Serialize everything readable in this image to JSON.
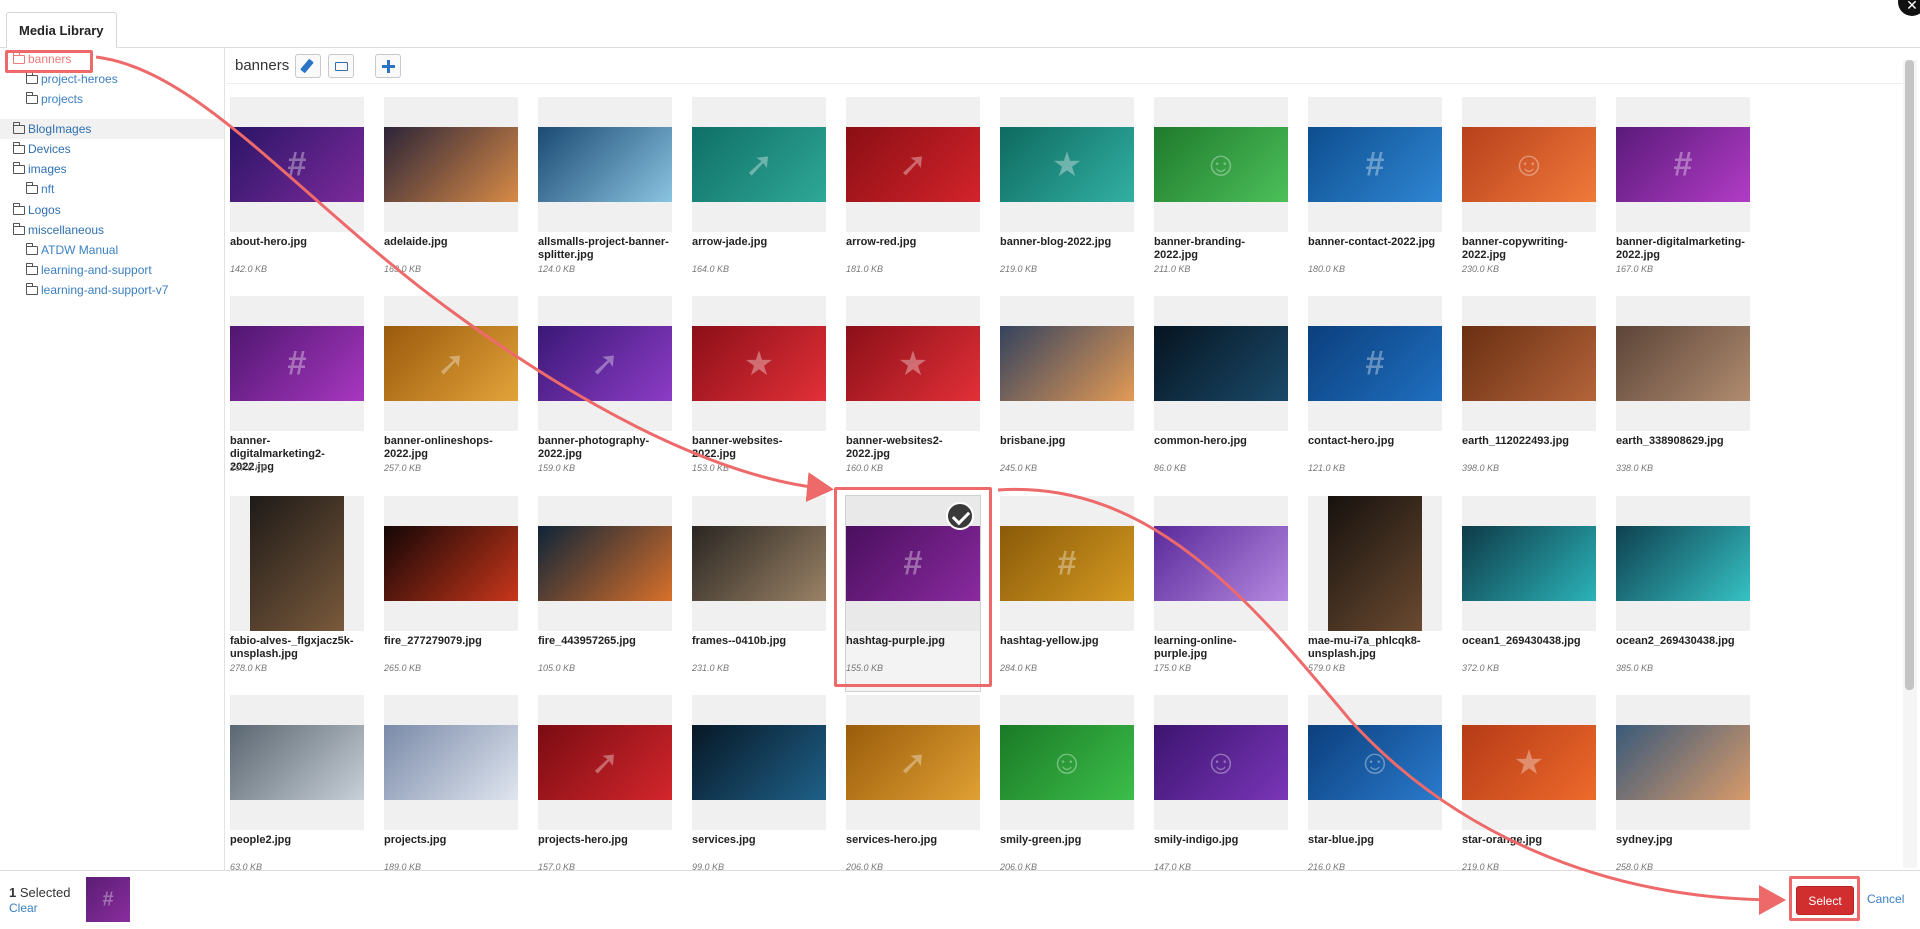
{
  "tabs": [
    {
      "label": "Media Library"
    }
  ],
  "close_icon": "close-icon",
  "folder_tree": [
    {
      "label": "banners",
      "level": 0,
      "active": true
    },
    {
      "label": "project-heroes",
      "level": 1
    },
    {
      "label": "projects",
      "level": 1
    },
    {
      "label": "BlogImages",
      "level": 0
    },
    {
      "label": "Devices",
      "level": 0
    },
    {
      "label": "images",
      "level": 0
    },
    {
      "label": "nft",
      "level": 1
    },
    {
      "label": "Logos",
      "level": 0
    },
    {
      "label": "miscellaneous",
      "level": 0
    },
    {
      "label": "ATDW Manual",
      "level": 1
    },
    {
      "label": "learning-and-support",
      "level": 1
    },
    {
      "label": "learning-and-support-v7",
      "level": 1
    }
  ],
  "header": {
    "title": "banners",
    "edit_icon": "pencil-icon",
    "folder_icon": "folder-icon",
    "add_icon": "plus-icon"
  },
  "files": [
    {
      "name": "about-hero.jpg",
      "size": "142.0 KB",
      "c1": "#2a1566",
      "c2": "#7d2a9c",
      "glyph": "#"
    },
    {
      "name": "adelaide.jpg",
      "size": "163.0 KB",
      "c1": "#2c2538",
      "c2": "#d88a46",
      "glyph": ""
    },
    {
      "name": "allsmalls-project-banner-splitter.jpg",
      "size": "124.0 KB",
      "c1": "#1b4a73",
      "c2": "#8ac3e0",
      "glyph": ""
    },
    {
      "name": "arrow-jade.jpg",
      "size": "164.0 KB",
      "c1": "#0f6f66",
      "c2": "#2fa898",
      "glyph": "➚"
    },
    {
      "name": "arrow-red.jpg",
      "size": "181.0 KB",
      "c1": "#8a0f14",
      "c2": "#d3232b",
      "glyph": "➚"
    },
    {
      "name": "banner-blog-2022.jpg",
      "size": "219.0 KB",
      "c1": "#0e6a60",
      "c2": "#32b0a3",
      "glyph": "★"
    },
    {
      "name": "banner-branding-2022.jpg",
      "size": "211.0 KB",
      "c1": "#1f7a2c",
      "c2": "#4cc05a",
      "glyph": "☺"
    },
    {
      "name": "banner-contact-2022.jpg",
      "size": "180.0 KB",
      "c1": "#0d4e8f",
      "c2": "#2f86d3",
      "glyph": "#"
    },
    {
      "name": "banner-copywriting-2022.jpg",
      "size": "230.0 KB",
      "c1": "#b8401c",
      "c2": "#f07a3a",
      "glyph": "☺"
    },
    {
      "name": "banner-digitalmarketing-2022.jpg",
      "size": "167.0 KB",
      "c1": "#5a1a7a",
      "c2": "#b23cc6",
      "glyph": "#"
    },
    {
      "name": "banner-digitalmarketing2-2022.jpg",
      "size": "167.0 KB",
      "c1": "#4f1670",
      "c2": "#a837c0",
      "glyph": "#"
    },
    {
      "name": "banner-onlineshops-2022.jpg",
      "size": "257.0 KB",
      "c1": "#9a5a0c",
      "c2": "#e3a33a",
      "glyph": "➚"
    },
    {
      "name": "banner-photography-2022.jpg",
      "size": "159.0 KB",
      "c1": "#3a1877",
      "c2": "#8d3cc6",
      "glyph": "➚"
    },
    {
      "name": "banner-websites-2022.jpg",
      "size": "153.0 KB",
      "c1": "#8c0f18",
      "c2": "#e23038",
      "glyph": "★"
    },
    {
      "name": "banner-websites2-2022.jpg",
      "size": "160.0 KB",
      "c1": "#8c0f18",
      "c2": "#e23038",
      "glyph": "★"
    },
    {
      "name": "brisbane.jpg",
      "size": "245.0 KB",
      "c1": "#34435e",
      "c2": "#e39a55",
      "glyph": ""
    },
    {
      "name": "common-hero.jpg",
      "size": "86.0 KB",
      "c1": "#061420",
      "c2": "#1a4a6a",
      "glyph": ""
    },
    {
      "name": "contact-hero.jpg",
      "size": "121.0 KB",
      "c1": "#0b3f7d",
      "c2": "#1f6fc0",
      "glyph": "#"
    },
    {
      "name": "earth_112022493.jpg",
      "size": "398.0 KB",
      "c1": "#6a2f12",
      "c2": "#b4643a",
      "glyph": ""
    },
    {
      "name": "earth_338908629.jpg",
      "size": "338.0 KB",
      "c1": "#5c4438",
      "c2": "#b08c70",
      "glyph": ""
    },
    {
      "name": "fabio-alves-_flgxjacz5k-unsplash.jpg",
      "size": "278.0 KB",
      "c1": "#1e1a18",
      "c2": "#7a5a3c",
      "glyph": "",
      "tall": true
    },
    {
      "name": "fire_277279079.jpg",
      "size": "265.0 KB",
      "c1": "#140606",
      "c2": "#c8361a",
      "glyph": ""
    },
    {
      "name": "fire_443957265.jpg",
      "size": "105.0 KB",
      "c1": "#0e2438",
      "c2": "#d8702a",
      "glyph": ""
    },
    {
      "name": "frames--0410b.jpg",
      "size": "231.0 KB",
      "c1": "#2a2622",
      "c2": "#9a8266",
      "glyph": ""
    },
    {
      "name": "hashtag-purple.jpg",
      "size": "155.0 KB",
      "c1": "#4a0f5e",
      "c2": "#8a2aa0",
      "glyph": "#",
      "selected": true
    },
    {
      "name": "hashtag-yellow.jpg",
      "size": "284.0 KB",
      "c1": "#8a5a08",
      "c2": "#d59a22",
      "glyph": "#"
    },
    {
      "name": "learning-online-purple.jpg",
      "size": "175.0 KB",
      "c1": "#5a2a9a",
      "c2": "#b488e0",
      "glyph": ""
    },
    {
      "name": "mae-mu-i7a_phlcqk8-unsplash.jpg",
      "size": "579.0 KB",
      "c1": "#16110e",
      "c2": "#6a4a30",
      "glyph": "",
      "tall": true
    },
    {
      "name": "ocean1_269430438.jpg",
      "size": "372.0 KB",
      "c1": "#0e3a48",
      "c2": "#2bb3b8",
      "glyph": ""
    },
    {
      "name": "ocean2_269430438.jpg",
      "size": "385.0 KB",
      "c1": "#0e4050",
      "c2": "#36c2c4",
      "glyph": ""
    },
    {
      "name": "people2.jpg",
      "size": "63.0 KB",
      "c1": "#5a6670",
      "c2": "#c8d0d8",
      "glyph": ""
    },
    {
      "name": "projects.jpg",
      "size": "189.0 KB",
      "c1": "#7a8aa8",
      "c2": "#e0e6f0",
      "glyph": ""
    },
    {
      "name": "projects-hero.jpg",
      "size": "157.0 KB",
      "c1": "#7a0c12",
      "c2": "#d3262c",
      "glyph": "➚"
    },
    {
      "name": "services.jpg",
      "size": "99.0 KB",
      "c1": "#071826",
      "c2": "#1f6088",
      "glyph": ""
    },
    {
      "name": "services-hero.jpg",
      "size": "206.0 KB",
      "c1": "#9a5c0a",
      "c2": "#e0a034",
      "glyph": "➚"
    },
    {
      "name": "smily-green.jpg",
      "size": "206.0 KB",
      "c1": "#1a7a26",
      "c2": "#3cbe4a",
      "glyph": "☺"
    },
    {
      "name": "smily-indigo.jpg",
      "size": "147.0 KB",
      "c1": "#3c1470",
      "c2": "#7a36b8",
      "glyph": "☺"
    },
    {
      "name": "star-blue.jpg",
      "size": "216.0 KB",
      "c1": "#0b3f7d",
      "c2": "#2a7acc",
      "glyph": "☺"
    },
    {
      "name": "star-orange.jpg",
      "size": "219.0 KB",
      "c1": "#b53a16",
      "c2": "#ee6a2c",
      "glyph": "★"
    },
    {
      "name": "sydney.jpg",
      "size": "258.0 KB",
      "c1": "#3a5a7a",
      "c2": "#d89a6a",
      "glyph": ""
    }
  ],
  "footer": {
    "selected_count": "1",
    "selected_label": " Selected",
    "clear_label": "Clear",
    "select_label": "Select",
    "cancel_label": "Cancel"
  },
  "annotation_color": "#ee6a6a"
}
